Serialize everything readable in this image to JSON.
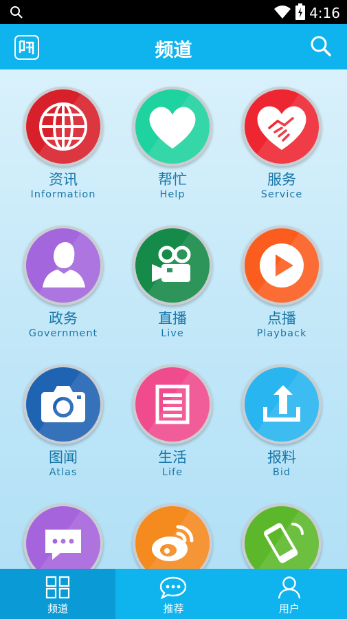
{
  "status_bar": {
    "time": "4:16"
  },
  "header": {
    "title": "频道"
  },
  "channels": [
    {
      "cn": "资讯",
      "en": "Information",
      "icon": "globe-icon",
      "color": "#d8202b"
    },
    {
      "cn": "帮忙",
      "en": "Help",
      "icon": "heart-icon",
      "color": "#1fd3a0"
    },
    {
      "cn": "服务",
      "en": "Service",
      "icon": "handshake-heart-icon",
      "color": "#ee2631"
    },
    {
      "cn": "政务",
      "en": "Government",
      "icon": "person-icon",
      "color": "#a366dd"
    },
    {
      "cn": "直播",
      "en": "Live",
      "icon": "video-camera-icon",
      "color": "#168a48"
    },
    {
      "cn": "点播",
      "en": "Playback",
      "icon": "play-icon",
      "color": "#fb5d1e"
    },
    {
      "cn": "图闻",
      "en": "Atlas",
      "icon": "camera-icon",
      "color": "#1f63b3"
    },
    {
      "cn": "生活",
      "en": "Life",
      "icon": "document-icon",
      "color": "#f04b8d"
    },
    {
      "cn": "报料",
      "en": "Bid",
      "icon": "upload-icon",
      "color": "#28b5f0"
    },
    {
      "cn": "",
      "en": "",
      "icon": "chat-bubble-icon",
      "color": "#a564dc"
    },
    {
      "cn": "",
      "en": "",
      "icon": "weibo-icon",
      "color": "#f58a1f"
    },
    {
      "cn": "",
      "en": "",
      "icon": "phone-icon",
      "color": "#5cb82a"
    }
  ],
  "tabs": [
    {
      "label": "频道",
      "icon": "grid-icon",
      "active": true
    },
    {
      "label": "推荐",
      "icon": "chat-icon",
      "active": false
    },
    {
      "label": "用户",
      "icon": "user-icon",
      "active": false
    }
  ]
}
